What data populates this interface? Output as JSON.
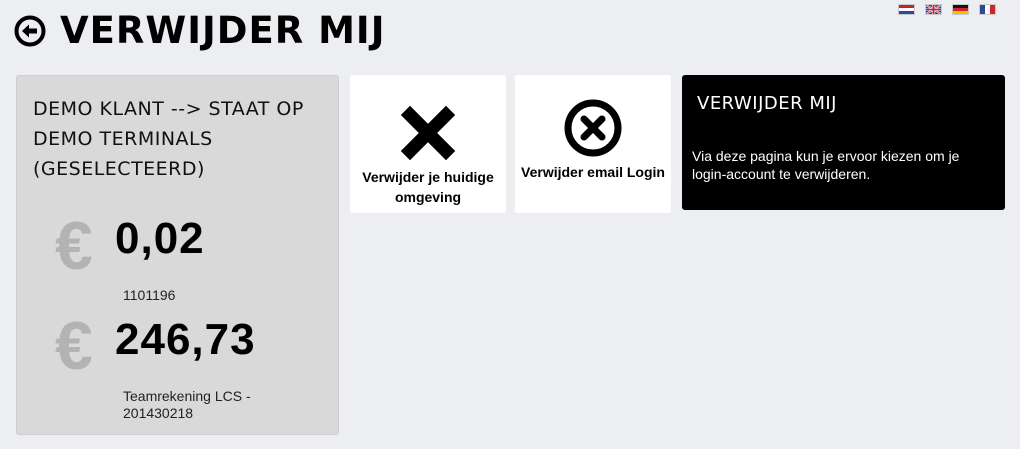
{
  "header": {
    "title": "VERWIJDER MIJ",
    "back_icon": "arrow-left-circle-icon"
  },
  "languages": [
    {
      "code": "nl",
      "icon": "flag-netherlands-icon"
    },
    {
      "code": "en",
      "icon": "flag-uk-icon"
    },
    {
      "code": "de",
      "icon": "flag-germany-icon"
    },
    {
      "code": "fr",
      "icon": "flag-france-icon"
    }
  ],
  "account": {
    "name": "DEMO KLANT --> STAAT OP DEMO TERMINALS (GESELECTEERD)",
    "currency_symbol": "€",
    "balances": [
      {
        "amount": "0,02",
        "label": "1101196"
      },
      {
        "amount": "246,73",
        "label": "Teamrekening LCS - 201430218"
      }
    ]
  },
  "actions": [
    {
      "label": "Verwijder je huidige omgeving",
      "icon": "x-cross-icon"
    },
    {
      "label": "Verwijder email Login",
      "icon": "x-circle-icon"
    }
  ],
  "info": {
    "title": "VERWIJDER MIJ",
    "text": "Via deze pagina kun je ervoor kiezen om je login-account te verwijderen."
  },
  "colors": {
    "background": "#eceef1",
    "panel": "#d9d9d9",
    "info_panel": "#000000",
    "euro_symbol": "#b3b3b3"
  }
}
